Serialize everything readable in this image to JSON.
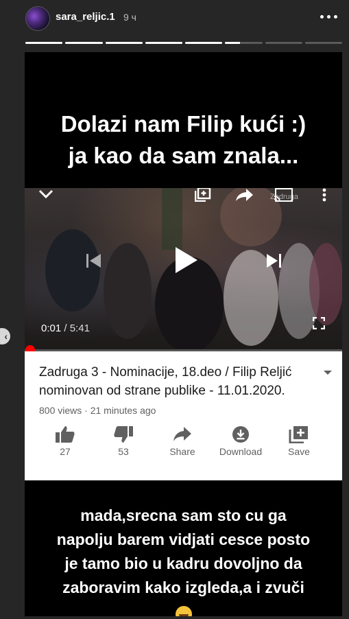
{
  "header": {
    "username": "sara_reljic.1",
    "time": "9 ч"
  },
  "progress": {
    "segments": [
      1,
      1,
      1,
      1,
      1,
      0.4,
      0,
      0
    ],
    "current_segment": 6
  },
  "story": {
    "top_caption_line1": "Dolazi nam Filip kući :)",
    "top_caption_line2": "ja kao da sam znala...",
    "video": {
      "current_time": "0:01",
      "separator": " / ",
      "duration": "5:41",
      "cast_text": "Zadruga",
      "progress_fraction": 0.003
    },
    "video_info": {
      "title": "Zadruga 3 - Nominacije, 18.deo / Filip Reljić nominovan od strane publike - 11.01.2020.",
      "meta": "800 views · 21 minutes ago",
      "actions": [
        {
          "icon": "thumbs-up-icon",
          "label": "27"
        },
        {
          "icon": "thumbs-down-icon",
          "label": "53"
        },
        {
          "icon": "share-icon",
          "label": "Share"
        },
        {
          "icon": "download-icon",
          "label": "Download"
        },
        {
          "icon": "save-icon",
          "label": "Save"
        }
      ]
    },
    "bottom_caption_line1": "mada,srecna sam sto cu ga",
    "bottom_caption_line2": "napolju barem vidjati cesce posto",
    "bottom_caption_line3": "je tamo bio u kadru dovoljno da",
    "bottom_caption_line4": "zaboravim kako izgleda,a i zvuči",
    "emoji": "grinning-sweat-emoji"
  },
  "colors": {
    "background": "#262626",
    "scrub_red": "#ff0000",
    "meta_gray": "#606060"
  }
}
